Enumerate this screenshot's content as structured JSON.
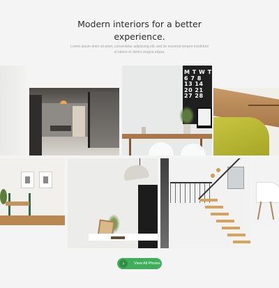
{
  "hero": {
    "title_line1": "Modern interiors for a better",
    "title_line2": "experience.",
    "subtitle": "Lorem ipsum dolor sit amet, consectetur adipiscing elit, sed do eiusmod tempor incididunt ut labore et dolore magna aliqua."
  },
  "gallery": {
    "calendar_letters": [
      "M",
      "T",
      "W",
      "T"
    ],
    "calendar_rows": [
      "6 7 8",
      "13 14",
      "20 21",
      "27 28"
    ]
  },
  "cta": {
    "label": "View All Photos",
    "icon": "chevron-right-icon"
  },
  "colors": {
    "accent": "#3eae59",
    "background": "#f4f4f4"
  }
}
